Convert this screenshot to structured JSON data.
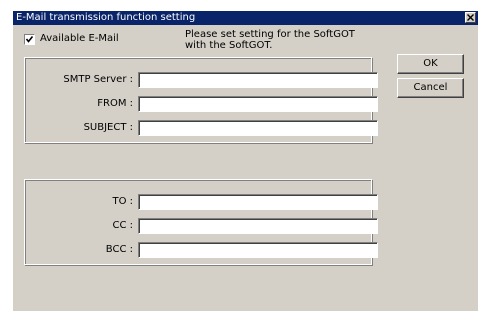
{
  "window": {
    "title": "E-Mail transmission function setting",
    "close_symbol": "✕"
  },
  "options": {
    "available_email_label": "Available E-Mail",
    "available_email_checked": true
  },
  "note": {
    "line1": "Please set setting for the SoftGOT",
    "line2": "with the SoftGOT."
  },
  "server_group": {
    "fields": [
      {
        "label": "SMTP Server  :",
        "value": ""
      },
      {
        "label": "FROM  :",
        "value": ""
      },
      {
        "label": "SUBJECT  :",
        "value": ""
      }
    ]
  },
  "recipient_group": {
    "fields": [
      {
        "label": "TO  :",
        "value": ""
      },
      {
        "label": "CC  :",
        "value": ""
      },
      {
        "label": "BCC  :",
        "value": ""
      }
    ]
  },
  "buttons": {
    "ok_label": "OK",
    "cancel_label": "Cancel"
  },
  "colors": {
    "titlebar": "#0a246a",
    "dialog_face": "#d4d0c8"
  },
  "icons": {
    "close": "close-icon",
    "check": "checkmark-icon"
  }
}
